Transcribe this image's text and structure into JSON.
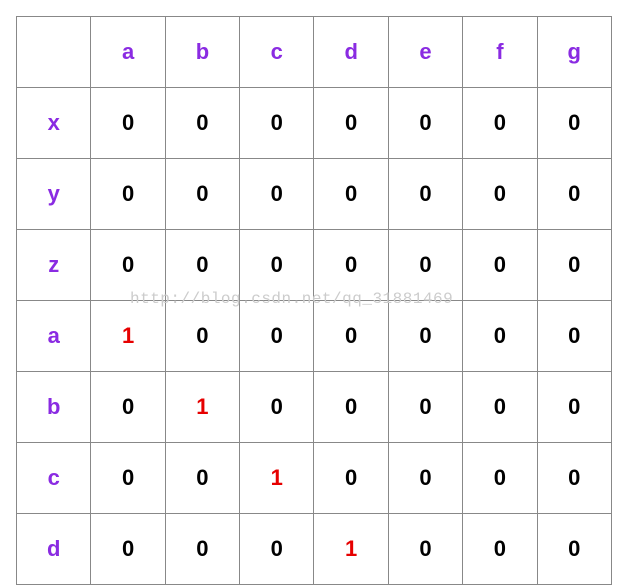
{
  "table": {
    "col_headers": [
      "a",
      "b",
      "c",
      "d",
      "e",
      "f",
      "g"
    ],
    "row_headers": [
      "x",
      "y",
      "z",
      "a",
      "b",
      "c",
      "d"
    ],
    "cells": [
      [
        "0",
        "0",
        "0",
        "0",
        "0",
        "0",
        "0"
      ],
      [
        "0",
        "0",
        "0",
        "0",
        "0",
        "0",
        "0"
      ],
      [
        "0",
        "0",
        "0",
        "0",
        "0",
        "0",
        "0"
      ],
      [
        "1",
        "0",
        "0",
        "0",
        "0",
        "0",
        "0"
      ],
      [
        "0",
        "1",
        "0",
        "0",
        "0",
        "0",
        "0"
      ],
      [
        "0",
        "0",
        "1",
        "0",
        "0",
        "0",
        "0"
      ],
      [
        "0",
        "0",
        "0",
        "1",
        "0",
        "0",
        "0"
      ]
    ]
  },
  "watermark": "http://blog.csdn.net/qq_31881469"
}
